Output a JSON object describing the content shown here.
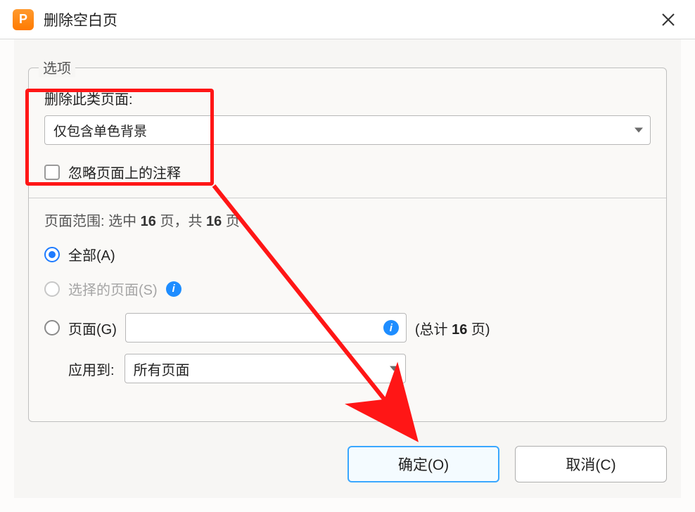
{
  "window": {
    "title": "删除空白页",
    "app_icon_letter": "P"
  },
  "options": {
    "legend": "选项",
    "delete_type_label": "删除此类页面:",
    "delete_type_value": "仅包含单色背景",
    "ignore_annotations_label": "忽略页面上的注释"
  },
  "range": {
    "title_prefix": "页面范围: 选中 ",
    "selected_count": "16",
    "title_mid": " 页，共 ",
    "total_count": "16",
    "title_suffix": " 页",
    "radio_all": "全部(A)",
    "radio_selected_pages": "选择的页面(S)",
    "radio_pages": "页面(G)",
    "total_text_prefix": "(总计 ",
    "total_text_count": "16",
    "total_text_suffix": " 页)",
    "apply_to_label": "应用到:",
    "apply_to_value": "所有页面"
  },
  "footer": {
    "ok": "确定(O)",
    "cancel": "取消(C)"
  }
}
